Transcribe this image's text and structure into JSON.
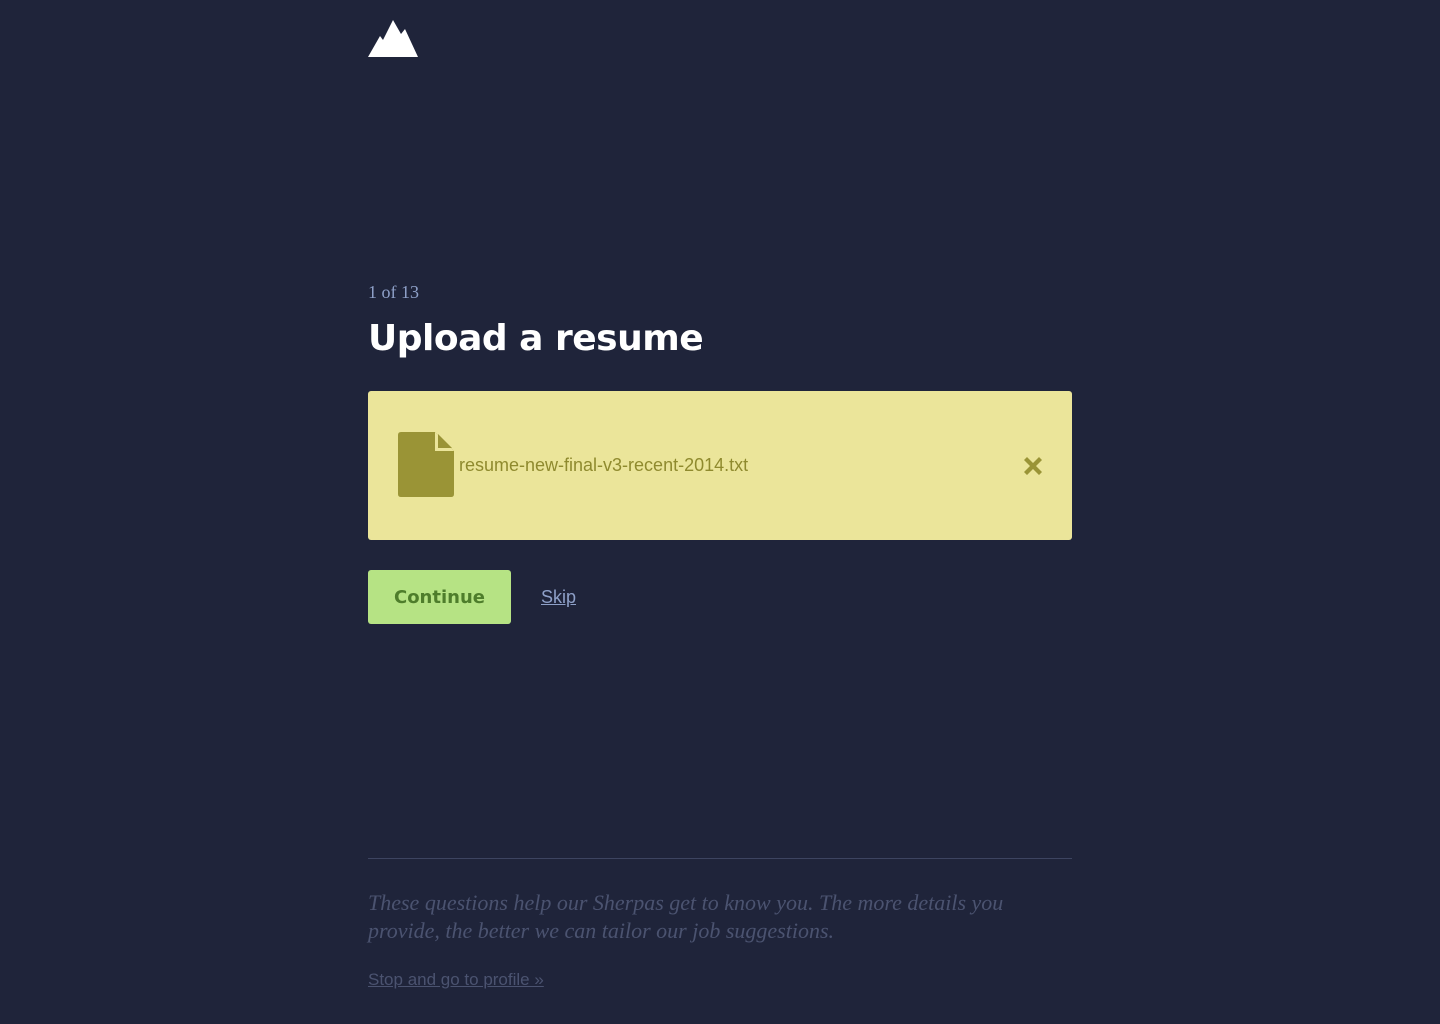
{
  "brand": {
    "logo_icon": "mountain-icon"
  },
  "progress": {
    "step_text": "1 of 13"
  },
  "page": {
    "title": "Upload a resume"
  },
  "upload": {
    "file_icon": "document-icon",
    "file_name": "resume-new-final-v3-recent-2014.txt",
    "remove_icon": "close-x-icon"
  },
  "actions": {
    "continue_label": "Continue",
    "skip_label": "Skip"
  },
  "footer": {
    "note": "These questions help our Sherpas get to know you. The more details you provide, the better we can tailor our job suggestions.",
    "profile_link": "Stop and go to profile »"
  },
  "colors": {
    "background": "#1f243a",
    "upload_box": "#ebe59a",
    "file_accent": "#9a9436",
    "continue_bg": "#b6e384",
    "continue_text": "#4e7d2b",
    "muted_link": "#8ea0c8"
  }
}
